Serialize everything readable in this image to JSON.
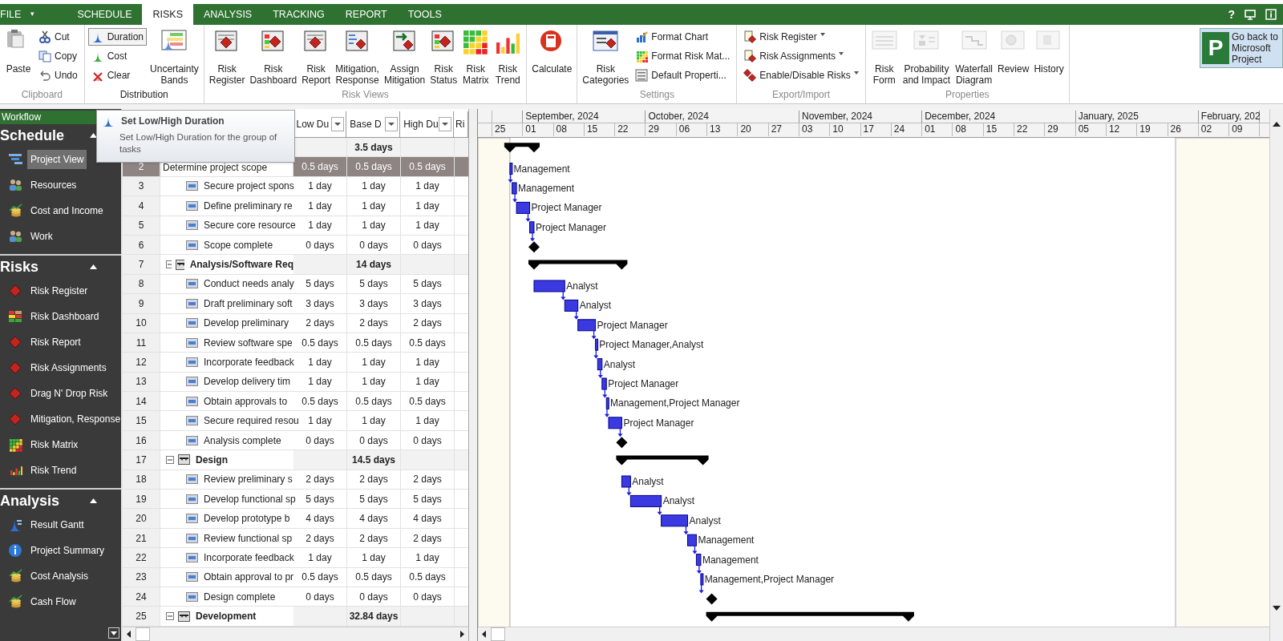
{
  "tabs": [
    {
      "label": "FILE",
      "caret": "▾",
      "selected": false
    },
    {
      "label": "SCHEDULE",
      "selected": false
    },
    {
      "label": "RISKS",
      "selected": true
    },
    {
      "label": "ANALYSIS",
      "selected": false
    },
    {
      "label": "TRACKING",
      "selected": false
    },
    {
      "label": "REPORT",
      "selected": false
    },
    {
      "label": "TOOLS",
      "selected": false
    }
  ],
  "help": "?",
  "ribbon": [
    {
      "label": "Clipboard",
      "active": false,
      "items": [
        {
          "kind": "large",
          "label": "Paste"
        },
        {
          "kind": "small",
          "label": "Cut"
        },
        {
          "kind": "small",
          "label": "Copy"
        },
        {
          "kind": "small",
          "label": "Undo"
        }
      ]
    },
    {
      "label": "Distribution",
      "active": true,
      "items": [
        {
          "kind": "small",
          "label": "Duration",
          "highlighted": true
        },
        {
          "kind": "small",
          "label": "Cost",
          "highlighted": false
        },
        {
          "kind": "small",
          "label": "Clear",
          "highlighted": false
        },
        {
          "kind": "large",
          "label": "Uncertainty\nBands"
        }
      ]
    },
    {
      "label": "Risk Views",
      "active": false,
      "items": [
        {
          "kind": "large",
          "label": "Risk\nRegister"
        },
        {
          "kind": "large",
          "label": "Risk\nDashboard"
        },
        {
          "kind": "large",
          "label": "Risk\nReport"
        },
        {
          "kind": "large",
          "label": "Mitigation,\nResponse"
        },
        {
          "kind": "large",
          "label": "Assign\nMitigation"
        },
        {
          "kind": "large",
          "label": "Risk\nStatus"
        },
        {
          "kind": "large",
          "label": "Risk\nMatrix"
        },
        {
          "kind": "large",
          "label": "Risk\nTrend"
        }
      ]
    },
    {
      "items": [
        {
          "kind": "large",
          "label": "Calculate"
        }
      ]
    },
    {
      "label": "Settings",
      "active": false,
      "items": [
        {
          "kind": "large",
          "label": "Risk\nCategories"
        },
        {
          "kind": "small",
          "label": "Format Chart"
        },
        {
          "kind": "small",
          "label": "Format Risk Mat..."
        },
        {
          "kind": "small",
          "label": "Default Properti..."
        }
      ]
    },
    {
      "label": "Export/Import",
      "active": false,
      "items": [
        {
          "kind": "small",
          "label": "Risk Register",
          "dropdown": true
        },
        {
          "kind": "small",
          "label": "Risk Assignments",
          "dropdown": true
        },
        {
          "kind": "small",
          "label": "Enable/Disable Risks",
          "dropdown": true
        }
      ]
    },
    {
      "label": "Properties",
      "active": false,
      "items": [
        {
          "kind": "large",
          "label": "Risk\nForm",
          "disabled": true
        },
        {
          "kind": "large",
          "label": "Probability\nand Impact",
          "disabled": true
        },
        {
          "kind": "large",
          "label": "Waterfall\nDiagram",
          "disabled": true
        },
        {
          "kind": "large",
          "label": "Review",
          "disabled": true
        },
        {
          "kind": "large",
          "label": "History",
          "disabled": true
        }
      ]
    }
  ],
  "back_button": {
    "logo": "P",
    "label": "Go back to\nMicrosoft\nProject"
  },
  "workflow": {
    "title": "Workflow",
    "sections": [
      {
        "title": "Schedule",
        "expanded": true,
        "items": [
          {
            "label": "Project View",
            "selected": true
          },
          {
            "label": "Resources",
            "selected": false
          },
          {
            "label": "Cost and Income",
            "selected": false
          },
          {
            "label": "Work",
            "selected": false
          }
        ]
      },
      {
        "title": "Risks",
        "expanded": true,
        "items": [
          {
            "label": "Risk Register",
            "selected": false
          },
          {
            "label": "Risk Dashboard",
            "selected": false
          },
          {
            "label": "Risk Report",
            "selected": false
          },
          {
            "label": "Risk Assignments",
            "selected": false
          },
          {
            "label": "Drag N' Drop Risk",
            "selected": false
          },
          {
            "label": "Mitigation, Response",
            "selected": false
          },
          {
            "label": "Risk Matrix",
            "selected": false
          },
          {
            "label": "Risk Trend",
            "selected": false
          }
        ]
      },
      {
        "title": "Analysis",
        "expanded": true,
        "items": [
          {
            "label": "Result Gantt",
            "selected": false
          },
          {
            "label": "Project Summary",
            "selected": false
          },
          {
            "label": "Cost Analysis",
            "selected": false
          },
          {
            "label": "Cash Flow",
            "selected": false
          }
        ]
      }
    ]
  },
  "tooltip": {
    "title": "Set Low/High Duration",
    "text": "Set Low/High Duration for the group of tasks"
  },
  "table": {
    "columns": [
      "Low Du",
      "Base D",
      "High Du",
      "Ri"
    ],
    "tasks": [
      {
        "kind": "summary",
        "base": "3.5 days",
        "expanded": true,
        "children": [
          {
            "kind": "task",
            "id": "2",
            "name": "Determine project scope",
            "low": "0.5 days",
            "base": "0.5 days",
            "high": "0.5 days",
            "resource": "Management",
            "selected": true
          },
          {
            "kind": "task",
            "id": "3",
            "name": "Secure project spons",
            "low": "1 day",
            "base": "1 day",
            "high": "1 day",
            "resource": "Management",
            "selected": false
          },
          {
            "kind": "task",
            "id": "4",
            "name": "Define preliminary re",
            "low": "1 day",
            "base": "1 day",
            "high": "1 day",
            "resource": "Project Manager",
            "selected": false
          },
          {
            "kind": "task",
            "id": "5",
            "name": "Secure core resource",
            "low": "1 day",
            "base": "1 day",
            "high": "1 day",
            "resource": "Project Manager",
            "selected": false
          },
          {
            "kind": "task",
            "id": "6",
            "name": "Scope complete",
            "low": "0 days",
            "base": "0 days",
            "high": "0 days",
            "selected": false
          }
        ]
      },
      {
        "kind": "summary",
        "id": "7",
        "name": "Analysis/Software Req",
        "base": "14 days",
        "expanded": true,
        "children": [
          {
            "kind": "task",
            "id": "8",
            "name": "Conduct needs analy",
            "low": "5 days",
            "base": "5 days",
            "high": "5 days",
            "resource": "Analyst",
            "selected": false
          },
          {
            "kind": "task",
            "id": "9",
            "name": "Draft preliminary soft",
            "low": "3 days",
            "base": "3 days",
            "high": "3 days",
            "resource": "Analyst",
            "selected": false
          },
          {
            "kind": "task",
            "id": "10",
            "name": "Develop preliminary",
            "low": "2 days",
            "base": "2 days",
            "high": "2 days",
            "resource": "Project Manager",
            "selected": false
          },
          {
            "kind": "task",
            "id": "11",
            "name": "Review software spe",
            "low": "0.5 days",
            "base": "0.5 days",
            "high": "0.5 days",
            "resource": "Project Manager,Analyst",
            "selected": false
          },
          {
            "kind": "task",
            "id": "12",
            "name": "Incorporate feedback",
            "low": "1 day",
            "base": "1 day",
            "high": "1 day",
            "resource": "Analyst",
            "selected": false
          },
          {
            "kind": "task",
            "id": "13",
            "name": "Develop delivery tim",
            "low": "1 day",
            "base": "1 day",
            "high": "1 day",
            "resource": "Project Manager",
            "selected": false
          },
          {
            "kind": "task",
            "id": "14",
            "name": "Obtain approvals to",
            "low": "0.5 days",
            "base": "0.5 days",
            "high": "0.5 days",
            "resource": "Management,Project Manager",
            "selected": false
          },
          {
            "kind": "task",
            "id": "15",
            "name": "Secure required resou",
            "low": "1 day",
            "base": "1 day",
            "high": "1 day",
            "resource": "Project Manager",
            "selected": false
          },
          {
            "kind": "task",
            "id": "16",
            "name": "Analysis complete",
            "low": "0 days",
            "base": "0 days",
            "high": "0 days",
            "selected": false
          }
        ]
      },
      {
        "kind": "summary",
        "id": "17",
        "name": "Design",
        "base": "14.5 days",
        "expanded": true,
        "children": [
          {
            "kind": "task",
            "id": "18",
            "name": "Review preliminary s",
            "low": "2 days",
            "base": "2 days",
            "high": "2 days",
            "resource": "Analyst",
            "selected": false
          },
          {
            "kind": "task",
            "id": "19",
            "name": "Develop functional sp",
            "low": "5 days",
            "base": "5 days",
            "high": "5 days",
            "resource": "Analyst",
            "selected": false
          },
          {
            "kind": "task",
            "id": "20",
            "name": "Develop prototype b",
            "low": "4 days",
            "base": "4 days",
            "high": "4 days",
            "resource": "Analyst",
            "selected": false
          },
          {
            "kind": "task",
            "id": "21",
            "name": "Review functional sp",
            "low": "2 days",
            "base": "2 days",
            "high": "2 days",
            "resource": "Management",
            "selected": false
          },
          {
            "kind": "task",
            "id": "22",
            "name": "Incorporate feedback",
            "low": "1 day",
            "base": "1 day",
            "high": "1 day",
            "resource": "Management",
            "selected": false
          },
          {
            "kind": "task",
            "id": "23",
            "name": "Obtain approval to pr",
            "low": "0.5 days",
            "base": "0.5 days",
            "high": "0.5 days",
            "resource": "Management,Project Manager",
            "selected": false
          },
          {
            "kind": "task",
            "id": "24",
            "name": "Design complete",
            "low": "0 days",
            "base": "0 days",
            "high": "0 days",
            "selected": false
          }
        ]
      },
      {
        "kind": "summary",
        "id": "25",
        "name": "Development",
        "base": "32.84 days",
        "expanded": true
      }
    ]
  },
  "timescale": {
    "months": [
      {
        "weeks": [
          "25"
        ]
      },
      {
        "label": "September, 2024",
        "weeks": [
          "01",
          "08",
          "15",
          "22"
        ]
      },
      {
        "label": "October, 2024",
        "weeks": [
          "29",
          "06",
          "13",
          "20",
          "27"
        ]
      },
      {
        "label": "November, 2024",
        "weeks": [
          "03",
          "10",
          "17",
          "24"
        ]
      },
      {
        "label": "December, 2024",
        "weeks": [
          "01",
          "08",
          "15",
          "22",
          "29"
        ]
      },
      {
        "label": "January, 2025",
        "weeks": [
          "05",
          "12",
          "19",
          "26"
        ]
      },
      {
        "label": "February, 202",
        "weeks": [
          "02",
          "09"
        ]
      }
    ]
  }
}
